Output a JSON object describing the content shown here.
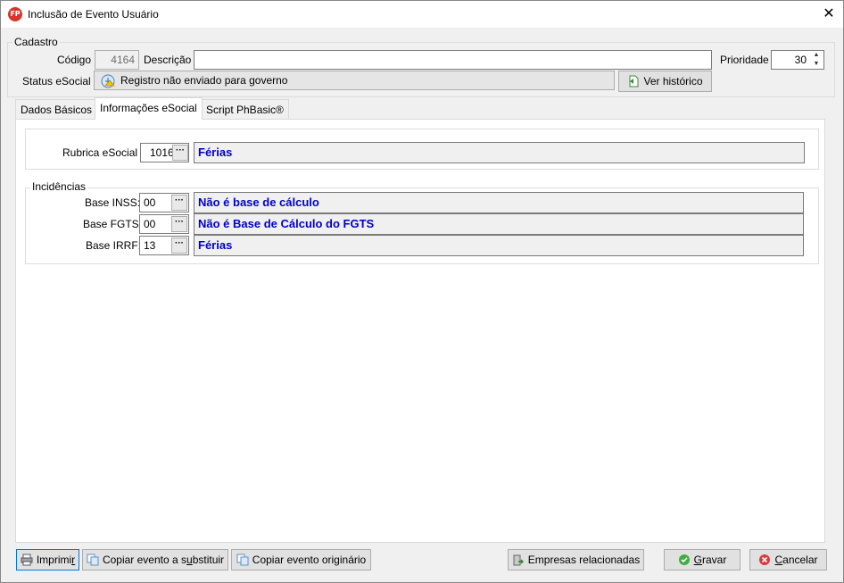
{
  "window": {
    "title": "Inclusão de Evento Usuário",
    "icon_text": "FP"
  },
  "cadastro": {
    "legend": "Cadastro",
    "codigo_label": "Código",
    "codigo_value": "4164",
    "descricao_label": "Descrição",
    "descricao_value": "",
    "prioridade_label": "Prioridade",
    "prioridade_value": "30",
    "status_label": "Status eSocial",
    "status_value": "Registro não enviado para governo",
    "ver_historico_label": "Ver histórico"
  },
  "tabs": [
    {
      "label": "Dados Básicos",
      "active": false
    },
    {
      "label": "Informações eSocial",
      "active": true
    },
    {
      "label": "Script PhBasic®",
      "active": false
    }
  ],
  "rubrica": {
    "label": "Rubrica eSocial",
    "code": "1016",
    "description": "Férias"
  },
  "incidencias": {
    "legend": "Incidências",
    "rows": [
      {
        "label": "Base INSS:",
        "code": "00",
        "description": "Não é base de cálculo"
      },
      {
        "label": "Base FGTS:",
        "code": "00",
        "description": "Não é Base de Cálculo do FGTS"
      },
      {
        "label": "Base IRRF:",
        "code": "13",
        "description": "Férias"
      }
    ]
  },
  "footer": {
    "imprimir_pre": "Imprimi",
    "imprimir_u": "r",
    "copiar_substituir_pre": "Copiar evento a s",
    "copiar_substituir_u": "u",
    "copiar_substituir_post": "bstituir",
    "copiar_originario": "Copiar evento originário",
    "empresas": "Empresas relacionadas",
    "gravar_u": "G",
    "gravar_post": "ravar",
    "cancelar_u": "C",
    "cancelar_post": "ancelar"
  },
  "colors": {
    "link_blue": "#0000cd",
    "accent_red": "#d9342b"
  }
}
